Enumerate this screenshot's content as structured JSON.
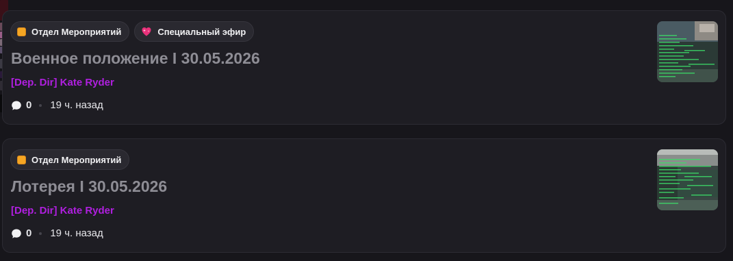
{
  "posts": [
    {
      "tags": [
        {
          "label": "Отдел Мероприятий",
          "icon": "orange-square-icon",
          "color": "#f5a623"
        },
        {
          "label": "Специальный эфир",
          "icon": "sparkling-heart-icon",
          "color": "#e8317a"
        }
      ],
      "title": "Военное положение I 30.05.2026",
      "author": "[Dep. Dir] Kate Ryder",
      "comments": "0",
      "time": "19 ч. назад",
      "thumbnail": "post-thumbnail"
    },
    {
      "tags": [
        {
          "label": "Отдел Мероприятий",
          "icon": "orange-square-icon",
          "color": "#f5a623"
        }
      ],
      "title": "Лотерея I 30.05.2026",
      "author": "[Dep. Dir] Kate Ryder",
      "comments": "0",
      "time": "19 ч. назад",
      "thumbnail": "post-thumbnail"
    }
  ],
  "colors": {
    "background": "#17161b",
    "card": "#1e1d23",
    "title": "#8e8d95",
    "author": "#b01fe0",
    "tag_bg": "#2a2930"
  }
}
